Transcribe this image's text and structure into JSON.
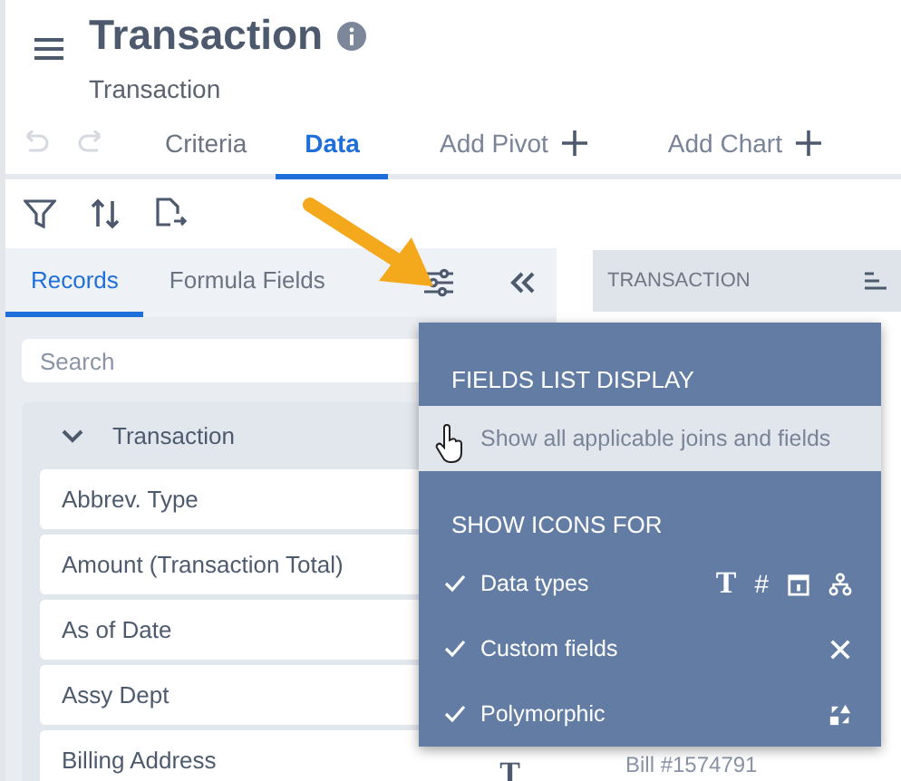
{
  "header": {
    "title": "Transaction",
    "subtitle": "Transaction"
  },
  "tabs": [
    {
      "label": "Criteria",
      "selected": false,
      "kind": "tab"
    },
    {
      "label": "Data",
      "selected": true,
      "kind": "tab"
    },
    {
      "label": "Add Pivot",
      "selected": false,
      "kind": "add"
    },
    {
      "label": "Add Chart",
      "selected": false,
      "kind": "add"
    }
  ],
  "panel_tabs": [
    {
      "label": "Records",
      "selected": true
    },
    {
      "label": "Formula Fields",
      "selected": false
    }
  ],
  "search": {
    "placeholder": "Search"
  },
  "record_group": {
    "label": "Transaction",
    "expanded": true,
    "fields": [
      {
        "label": "Abbrev. Type"
      },
      {
        "label": "Amount (Transaction Total)"
      },
      {
        "label": "As of Date"
      },
      {
        "label": "Assy Dept"
      },
      {
        "label": "Billing Address",
        "type_glyph": "T"
      }
    ]
  },
  "results": {
    "column_header": "TRANSACTION",
    "cell": "Bill #1574791"
  },
  "popup": {
    "sections": [
      {
        "heading": "FIELDS LIST DISPLAY",
        "items": [
          {
            "label": "Show all applicable joins and fields",
            "kind": "option",
            "checked": false,
            "hovered": true
          }
        ]
      },
      {
        "heading": "SHOW ICONS FOR",
        "items": [
          {
            "label": "Data types",
            "kind": "data_types",
            "checked": true,
            "hovered": false,
            "glyphs": [
              "T",
              "#"
            ]
          },
          {
            "label": "Custom fields",
            "kind": "custom_fields",
            "checked": true,
            "hovered": false
          },
          {
            "label": "Polymorphic",
            "kind": "polymorphic",
            "checked": true,
            "hovered": false
          }
        ]
      }
    ]
  }
}
